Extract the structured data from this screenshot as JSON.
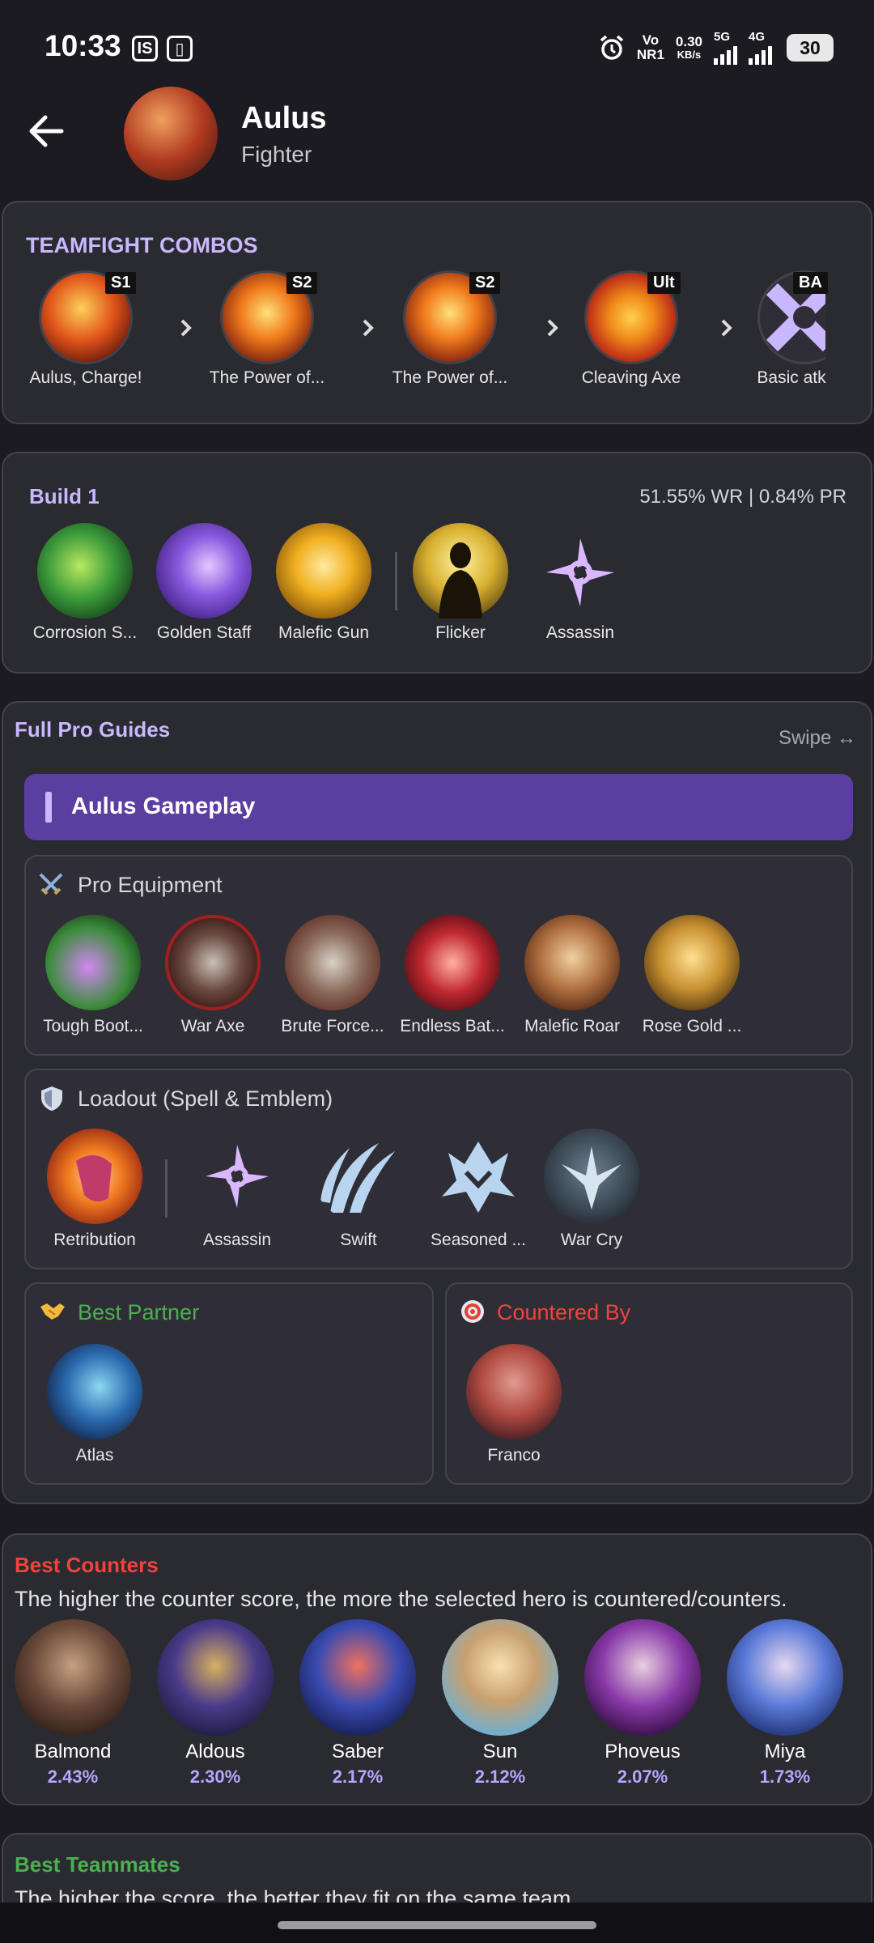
{
  "status_bar": {
    "time": "10:33",
    "icon1": "IS",
    "icon2": "▯",
    "net1_top": "Vo",
    "net1_bottom": "NR1",
    "speed_top": "0.30",
    "speed_bottom": "KB/s",
    "sig1": "5G",
    "sig2": "4G",
    "battery": "30"
  },
  "header": {
    "hero_name": "Aulus",
    "hero_role": "Fighter"
  },
  "combos": {
    "title": "TEAMFIGHT COMBOS",
    "items": [
      {
        "badge": "S1",
        "label": "Aulus, Charge!"
      },
      {
        "badge": "S2",
        "label": "The Power of..."
      },
      {
        "badge": "S2",
        "label": "The Power of..."
      },
      {
        "badge": "Ult",
        "label": "Cleaving Axe"
      },
      {
        "badge": "BA",
        "label": "Basic atk"
      }
    ]
  },
  "build": {
    "title": "Build 1",
    "stats": "51.55% WR | 0.84% PR",
    "items": [
      {
        "label": "Corrosion S..."
      },
      {
        "label": "Golden Staff"
      },
      {
        "label": "Malefic Gun"
      },
      {
        "label": "Flicker"
      },
      {
        "label": "Assassin"
      }
    ]
  },
  "guides": {
    "title": "Full Pro Guides",
    "swipe": "Swipe ↔",
    "banner": "Aulus Gameplay",
    "equipment_title": "Pro Equipment",
    "equipment": [
      {
        "label": "Tough Boot..."
      },
      {
        "label": "War Axe"
      },
      {
        "label": "Brute Force..."
      },
      {
        "label": "Endless Bat..."
      },
      {
        "label": "Malefic Roar"
      },
      {
        "label": "Rose Gold ..."
      }
    ],
    "loadout_title": "Loadout (Spell & Emblem)",
    "loadout": [
      {
        "label": "Retribution"
      },
      {
        "label": "Assassin"
      },
      {
        "label": "Swift"
      },
      {
        "label": "Seasoned ..."
      },
      {
        "label": "War Cry"
      }
    ],
    "partner_title": "Best Partner",
    "partner": "Atlas",
    "countered_title": "Countered By",
    "countered": "Franco"
  },
  "counters": {
    "title": "Best Counters",
    "desc": "The higher the counter score, the more the selected hero is countered/counters.",
    "heroes": [
      {
        "name": "Balmond",
        "pct": "2.43%"
      },
      {
        "name": "Aldous",
        "pct": "2.30%"
      },
      {
        "name": "Saber",
        "pct": "2.17%"
      },
      {
        "name": "Sun",
        "pct": "2.12%"
      },
      {
        "name": "Phoveus",
        "pct": "2.07%"
      },
      {
        "name": "Miya",
        "pct": "1.73%"
      }
    ]
  },
  "teammates": {
    "title": "Best Teammates",
    "desc": "The higher the score, the better they fit on the same team."
  },
  "colors": {
    "accent_purple": "#c9b7ff",
    "banner": "#5b3fa0",
    "green": "#4caf50",
    "red": "#f0443a"
  }
}
